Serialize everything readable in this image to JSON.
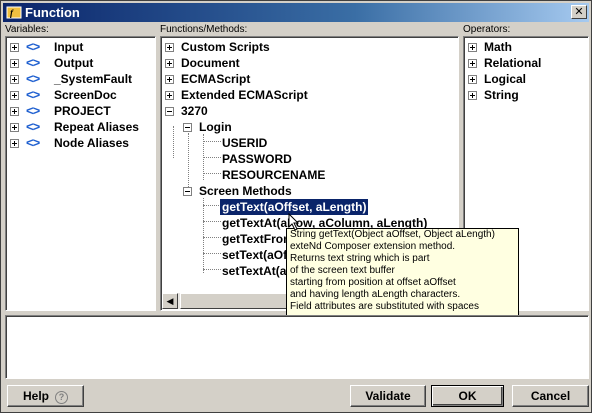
{
  "window": {
    "title": "Function",
    "close_glyph": "✕"
  },
  "variables": {
    "label": "Variables:",
    "items": [
      {
        "label": "Input"
      },
      {
        "label": "Output"
      },
      {
        "label": "_SystemFault"
      },
      {
        "label": "ScreenDoc"
      },
      {
        "label": "PROJECT"
      },
      {
        "label": "Repeat Aliases"
      },
      {
        "label": "Node Aliases"
      }
    ]
  },
  "functions": {
    "label": "Functions/Methods:",
    "items": {
      "custom_scripts": "Custom Scripts",
      "document": "Document",
      "ecmascript": "ECMAScript",
      "extended_ecmascript": "Extended ECMAScript",
      "group_3270": "3270",
      "login": "Login",
      "userid": "USERID",
      "password": "PASSWORD",
      "resourcename": "RESOURCENAME",
      "screen_methods": "Screen Methods",
      "m1": "getText(aOffset, aLength)",
      "m2": "getTextAt(aRow, aColumn, aLength)",
      "m3": "getTextFrom",
      "m4": "setText(aOf",
      "m5": "setTextAt(a"
    }
  },
  "operators": {
    "label": "Operators:",
    "items": [
      {
        "label": "Math"
      },
      {
        "label": "Relational"
      },
      {
        "label": "Logical"
      },
      {
        "label": "String"
      }
    ]
  },
  "tooltip": {
    "lines": [
      "String getText(Object aOffset, Object aLength)",
      "exteNd Composer extension method.",
      "Returns text string which is part",
      "of the screen text buffer",
      "starting from position at offset aOffset",
      "and having length aLength characters.",
      "Field attributes are substituted with spaces"
    ]
  },
  "buttons": {
    "help": "Help",
    "help_icon": "?",
    "validate": "Validate",
    "ok": "OK",
    "cancel": "Cancel"
  },
  "colors": {
    "accent": "#0a246a",
    "icon_blue": "#1e5fd0",
    "tooltip_bg": "#ffffe1"
  }
}
